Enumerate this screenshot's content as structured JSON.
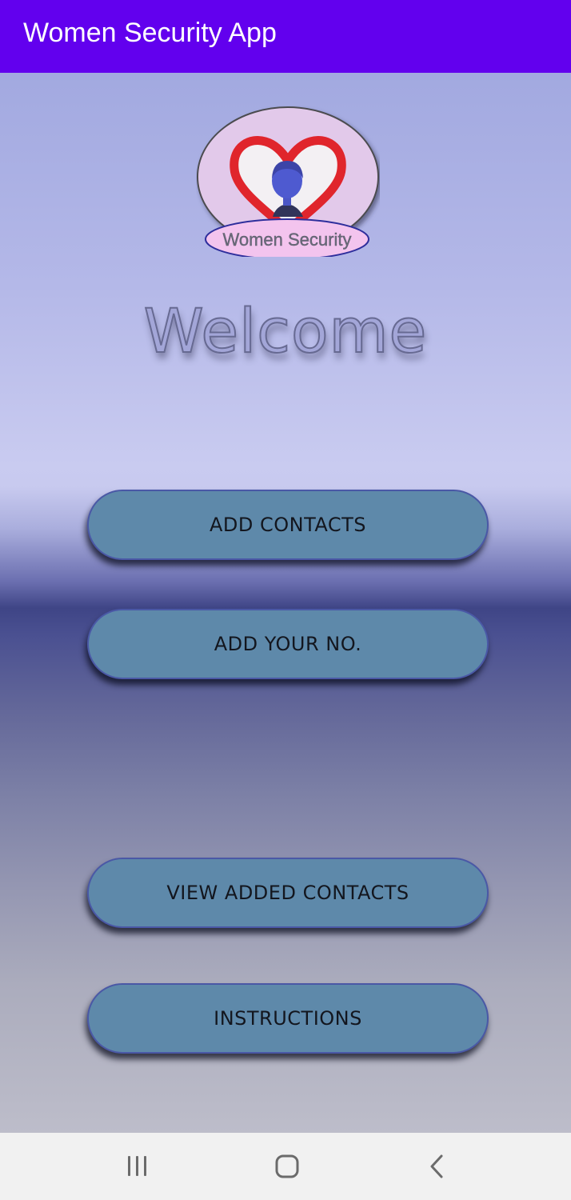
{
  "app_bar": {
    "title": "Women Security App",
    "background_color": "#6200ee"
  },
  "logo": {
    "text": "Women Security",
    "icon": "heart-woman-logo"
  },
  "welcome": {
    "text": "Welcome"
  },
  "buttons": {
    "add_contacts": "ADD CONTACTS",
    "add_your_no": "ADD YOUR NO.",
    "view_added_contacts": "VIEW ADDED CONTACTS",
    "instructions": "INSTRUCTIONS",
    "color": "#5e89aa"
  },
  "navigation_bar": {
    "recent_apps_icon": "recent-apps-icon",
    "home_icon": "home-icon",
    "back_icon": "back-icon"
  }
}
